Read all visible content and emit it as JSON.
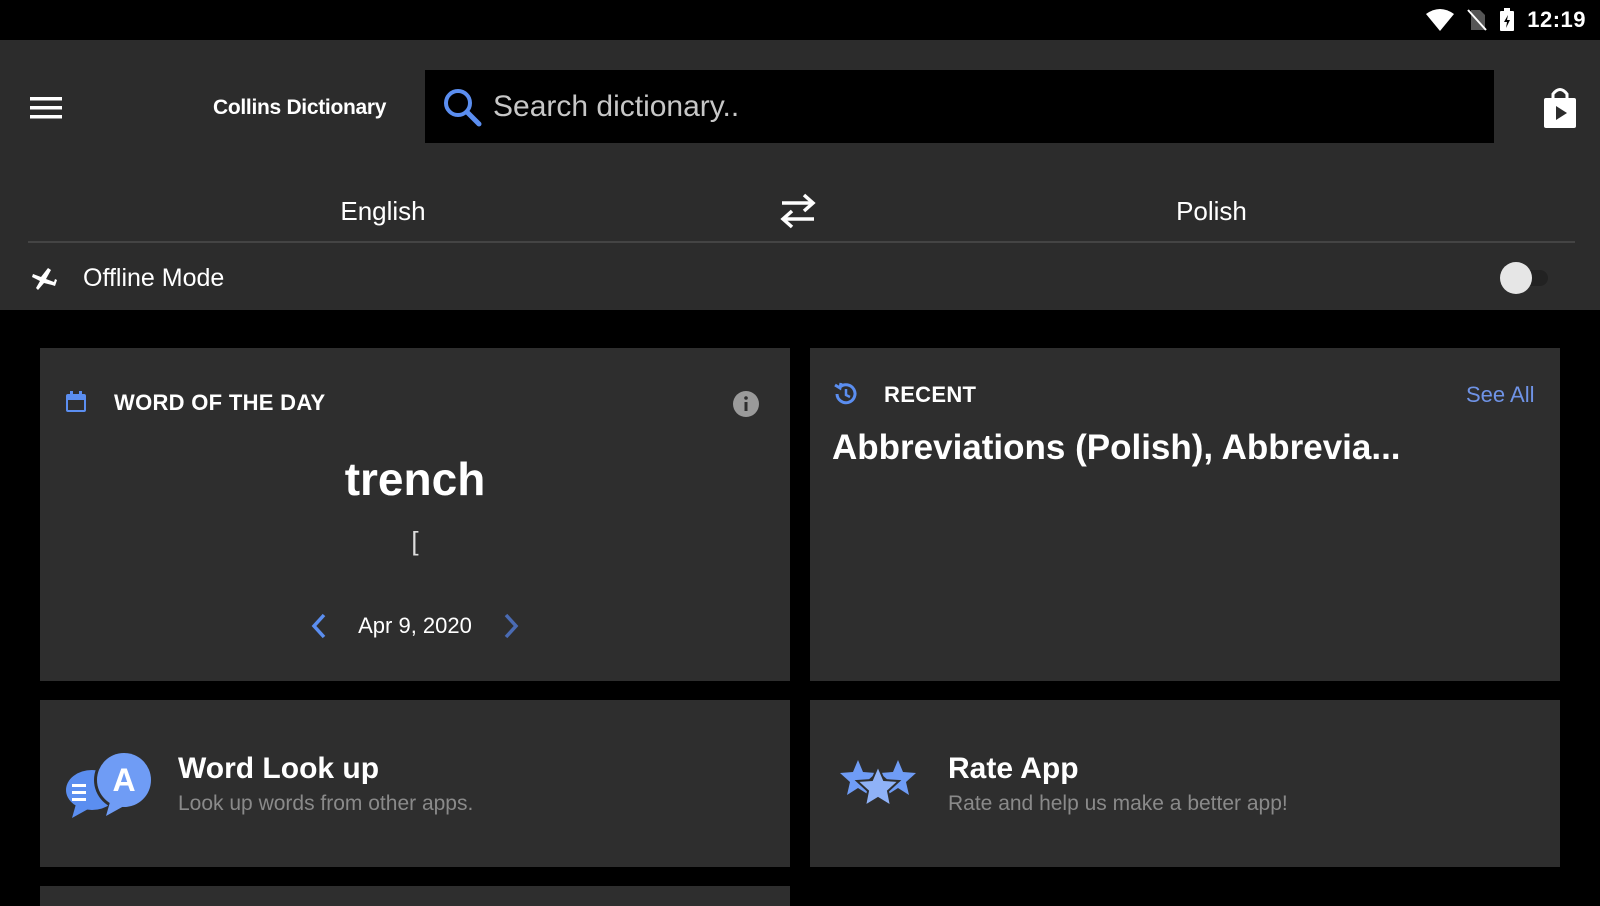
{
  "status": {
    "time": "12:19"
  },
  "header": {
    "title": "Collins Dictionary",
    "search_placeholder": "Search dictionary..",
    "icons": [
      "menu-icon",
      "search-icon",
      "store-bag-icon"
    ]
  },
  "languages": {
    "source": "English",
    "target": "Polish",
    "swap_icon": "swap-arrows-icon"
  },
  "offline": {
    "label": "Offline Mode",
    "enabled": false,
    "icon": "airplane-icon"
  },
  "word_of_the_day": {
    "label": "WORD OF THE DAY",
    "word": "trench",
    "pronunciation": "[",
    "date": "Apr 9, 2020",
    "icon": "calendar-icon"
  },
  "recent": {
    "label": "RECENT",
    "see_all": "See All",
    "text": "Abbreviations (Polish), Abbrevia...",
    "icon": "history-icon"
  },
  "features": [
    {
      "title": "Word Look up",
      "subtitle": "Look up words from other apps.",
      "icon": "speech-bubbles-icon"
    },
    {
      "title": "Rate App",
      "subtitle": "Rate and help us make a better app!",
      "icon": "stars-icon"
    }
  ],
  "colors": {
    "accent": "#6f93e6",
    "card": "#2e2e2e",
    "toolbar": "#2c2c2c",
    "background": "#000000"
  }
}
